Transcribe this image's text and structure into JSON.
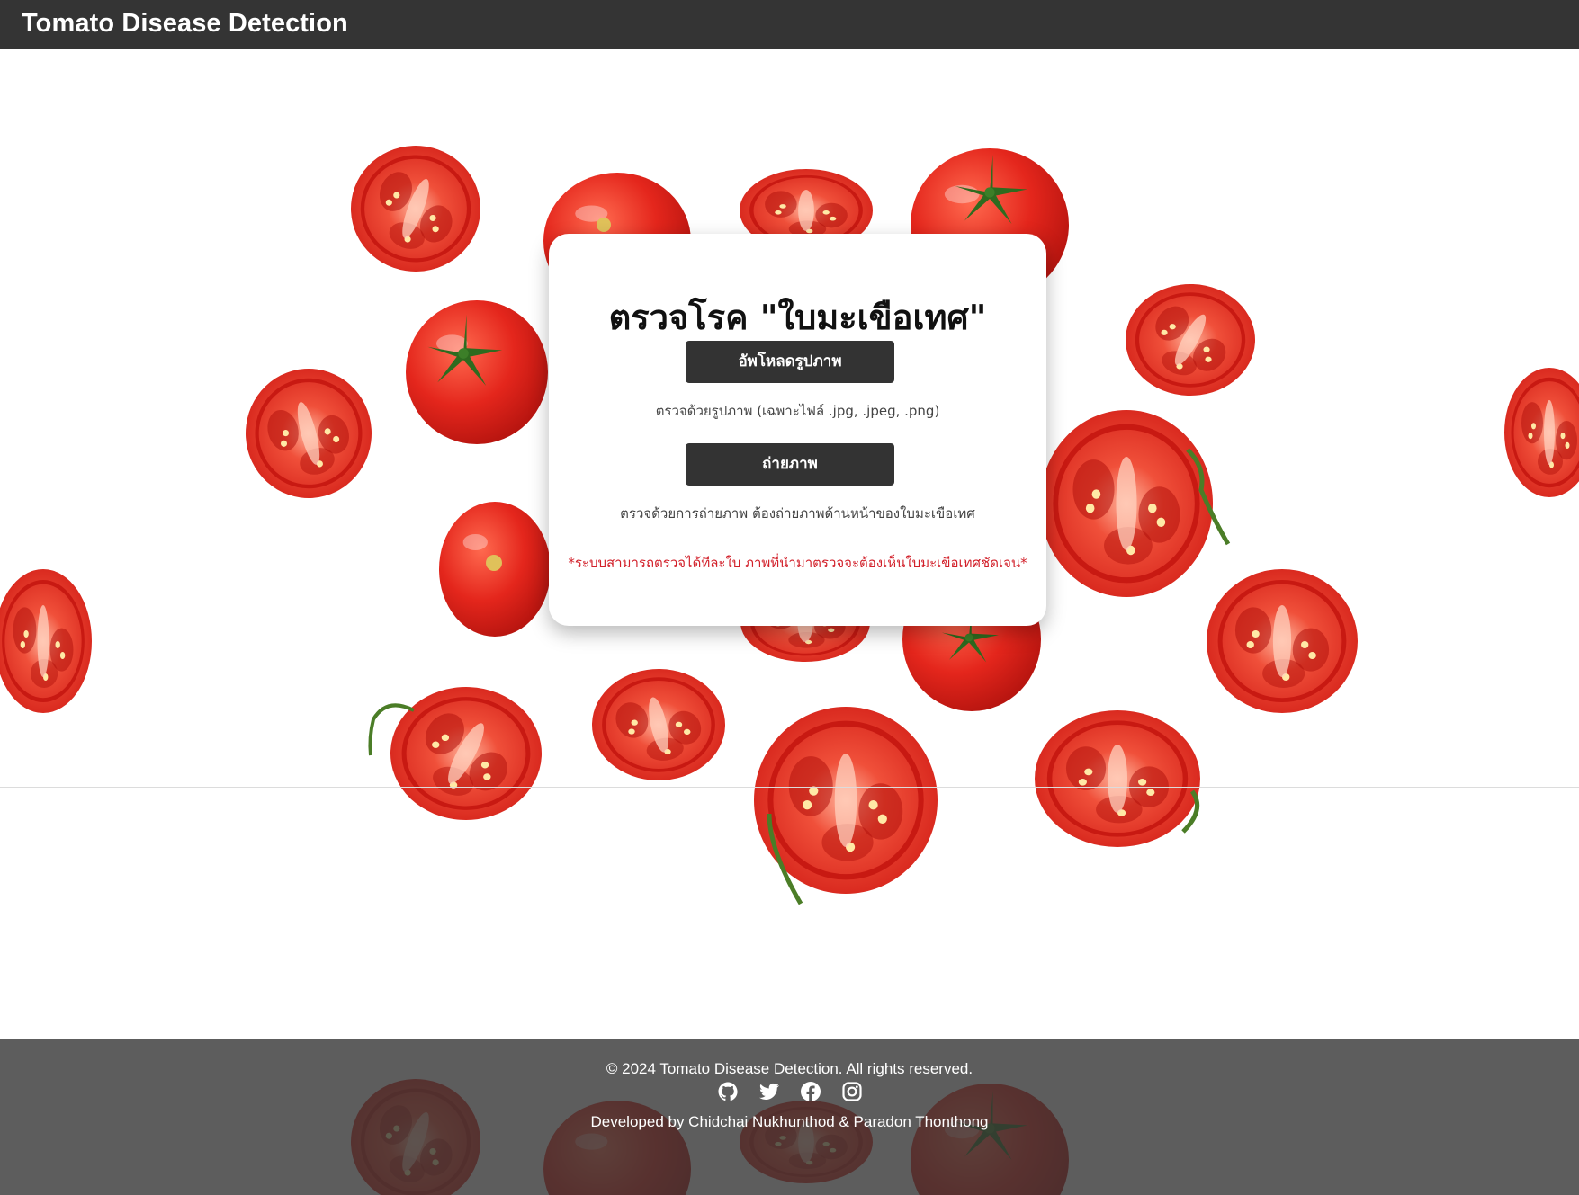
{
  "navbar": {
    "brand": "Tomato Disease Detection"
  },
  "card": {
    "title": "ตรวจโรค \"ใบมะเขือเทศ\"",
    "upload_button": "อัพโหลดรูปภาพ",
    "upload_hint": "ตรวจด้วยรูปภาพ (เฉพาะไฟล์ .jpg, .jpeg, .png)",
    "camera_button": "ถ่ายภาพ",
    "camera_hint": "ตรวจด้วยการถ่ายภาพ ต้องถ่ายภาพด้านหน้าของใบมะเขือเทศ",
    "warning": "*ระบบสามารถตรวจได้ทีละใบ ภาพที่นำมาตรวจจะต้องเห็นใบมะเขือเทศชัดเจน*"
  },
  "footer": {
    "copyright": "© 2024 Tomato Disease Detection. All rights reserved.",
    "social_icons": [
      "github-icon",
      "twitter-icon",
      "facebook-icon",
      "instagram-icon"
    ],
    "credit": "Developed by Chidchai Nukhunthod & Paradon Thonthong"
  },
  "colors": {
    "navbar_bg": "#343434",
    "button_bg": "#333333",
    "warning": "#d2202a",
    "tomato_red": "#e8281e"
  }
}
